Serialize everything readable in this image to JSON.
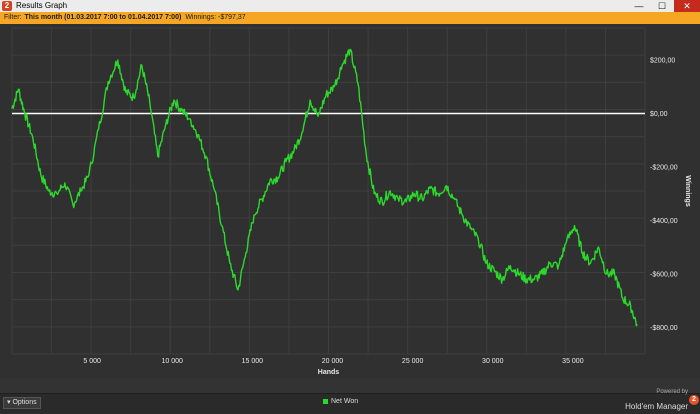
{
  "window": {
    "app_icon": "hm2-logo-icon",
    "title": "Results Graph",
    "minimize_glyph": "—",
    "maximize_glyph": "☐",
    "close_glyph": "✕"
  },
  "filter": {
    "prefix": "Filter:",
    "range": "This month (01.03.2017 7:00 to 01.04.2017 7:00)",
    "winnings_label": "Winnings:",
    "winnings_value": "-$797,37"
  },
  "footer": {
    "options_label": "Options",
    "options_glyph": "▾",
    "legend_label": "Net Won",
    "powered_by": "Powered by",
    "product": "Hold'em Manager",
    "badge": "2"
  },
  "colors": {
    "series": "#2bd92b",
    "zero_line": "#ffffff",
    "filter_bar": "#f5a623"
  },
  "chart_data": {
    "type": "line",
    "xlabel": "Hands",
    "ylabel": "Winnings",
    "xlim": [
      0,
      39500
    ],
    "ylim": [
      -900,
      320
    ],
    "x_ticks": [
      5000,
      10000,
      15000,
      20000,
      25000,
      30000,
      35000
    ],
    "x_tick_labels": [
      "5 000",
      "10 000",
      "15 000",
      "20 000",
      "25 000",
      "30 000",
      "35 000"
    ],
    "y_ticks": [
      200,
      0,
      -200,
      -400,
      -600,
      -800
    ],
    "y_tick_labels": [
      "$200,00",
      "$0,00",
      "-$200,00",
      "-$400,00",
      "-$600,00",
      "-$800,00"
    ],
    "grid": true,
    "legend_position": "bottom-center",
    "series": [
      {
        "name": "Net Won",
        "x": [
          0,
          400,
          800,
          1300,
          1800,
          2300,
          2800,
          3300,
          3800,
          4300,
          4800,
          5400,
          6000,
          6600,
          7100,
          7600,
          8100,
          8600,
          9100,
          9600,
          10100,
          10600,
          11100,
          11600,
          12100,
          12600,
          13100,
          13600,
          14100,
          14600,
          15100,
          15600,
          16100,
          16600,
          17100,
          17600,
          18100,
          18600,
          19100,
          19600,
          20100,
          20600,
          21100,
          21600,
          22100,
          22600,
          23100,
          23600,
          24100,
          24600,
          25100,
          25600,
          26100,
          26600,
          27100,
          27600,
          28100,
          28600,
          29100,
          29600,
          30100,
          30600,
          31100,
          31600,
          32100,
          32600,
          33100,
          33600,
          34100,
          34600,
          35100,
          35600,
          36100,
          36600,
          37100,
          37600,
          38100,
          38600,
          39000
        ],
        "y": [
          20,
          90,
          0,
          -90,
          -230,
          -290,
          -300,
          -260,
          -340,
          -290,
          -230,
          -60,
          120,
          200,
          80,
          60,
          180,
          40,
          -160,
          -40,
          50,
          10,
          -20,
          -80,
          -160,
          -280,
          -420,
          -560,
          -660,
          -520,
          -380,
          -320,
          -250,
          -240,
          -180,
          -140,
          -70,
          50,
          -10,
          70,
          100,
          180,
          240,
          110,
          -150,
          -300,
          -330,
          -290,
          -320,
          -330,
          -300,
          -320,
          -280,
          -300,
          -270,
          -320,
          -380,
          -430,
          -470,
          -560,
          -590,
          -620,
          -570,
          -600,
          -620,
          -620,
          -600,
          -560,
          -570,
          -480,
          -420,
          -520,
          -560,
          -500,
          -600,
          -600,
          -690,
          -720,
          -790
        ]
      }
    ]
  }
}
